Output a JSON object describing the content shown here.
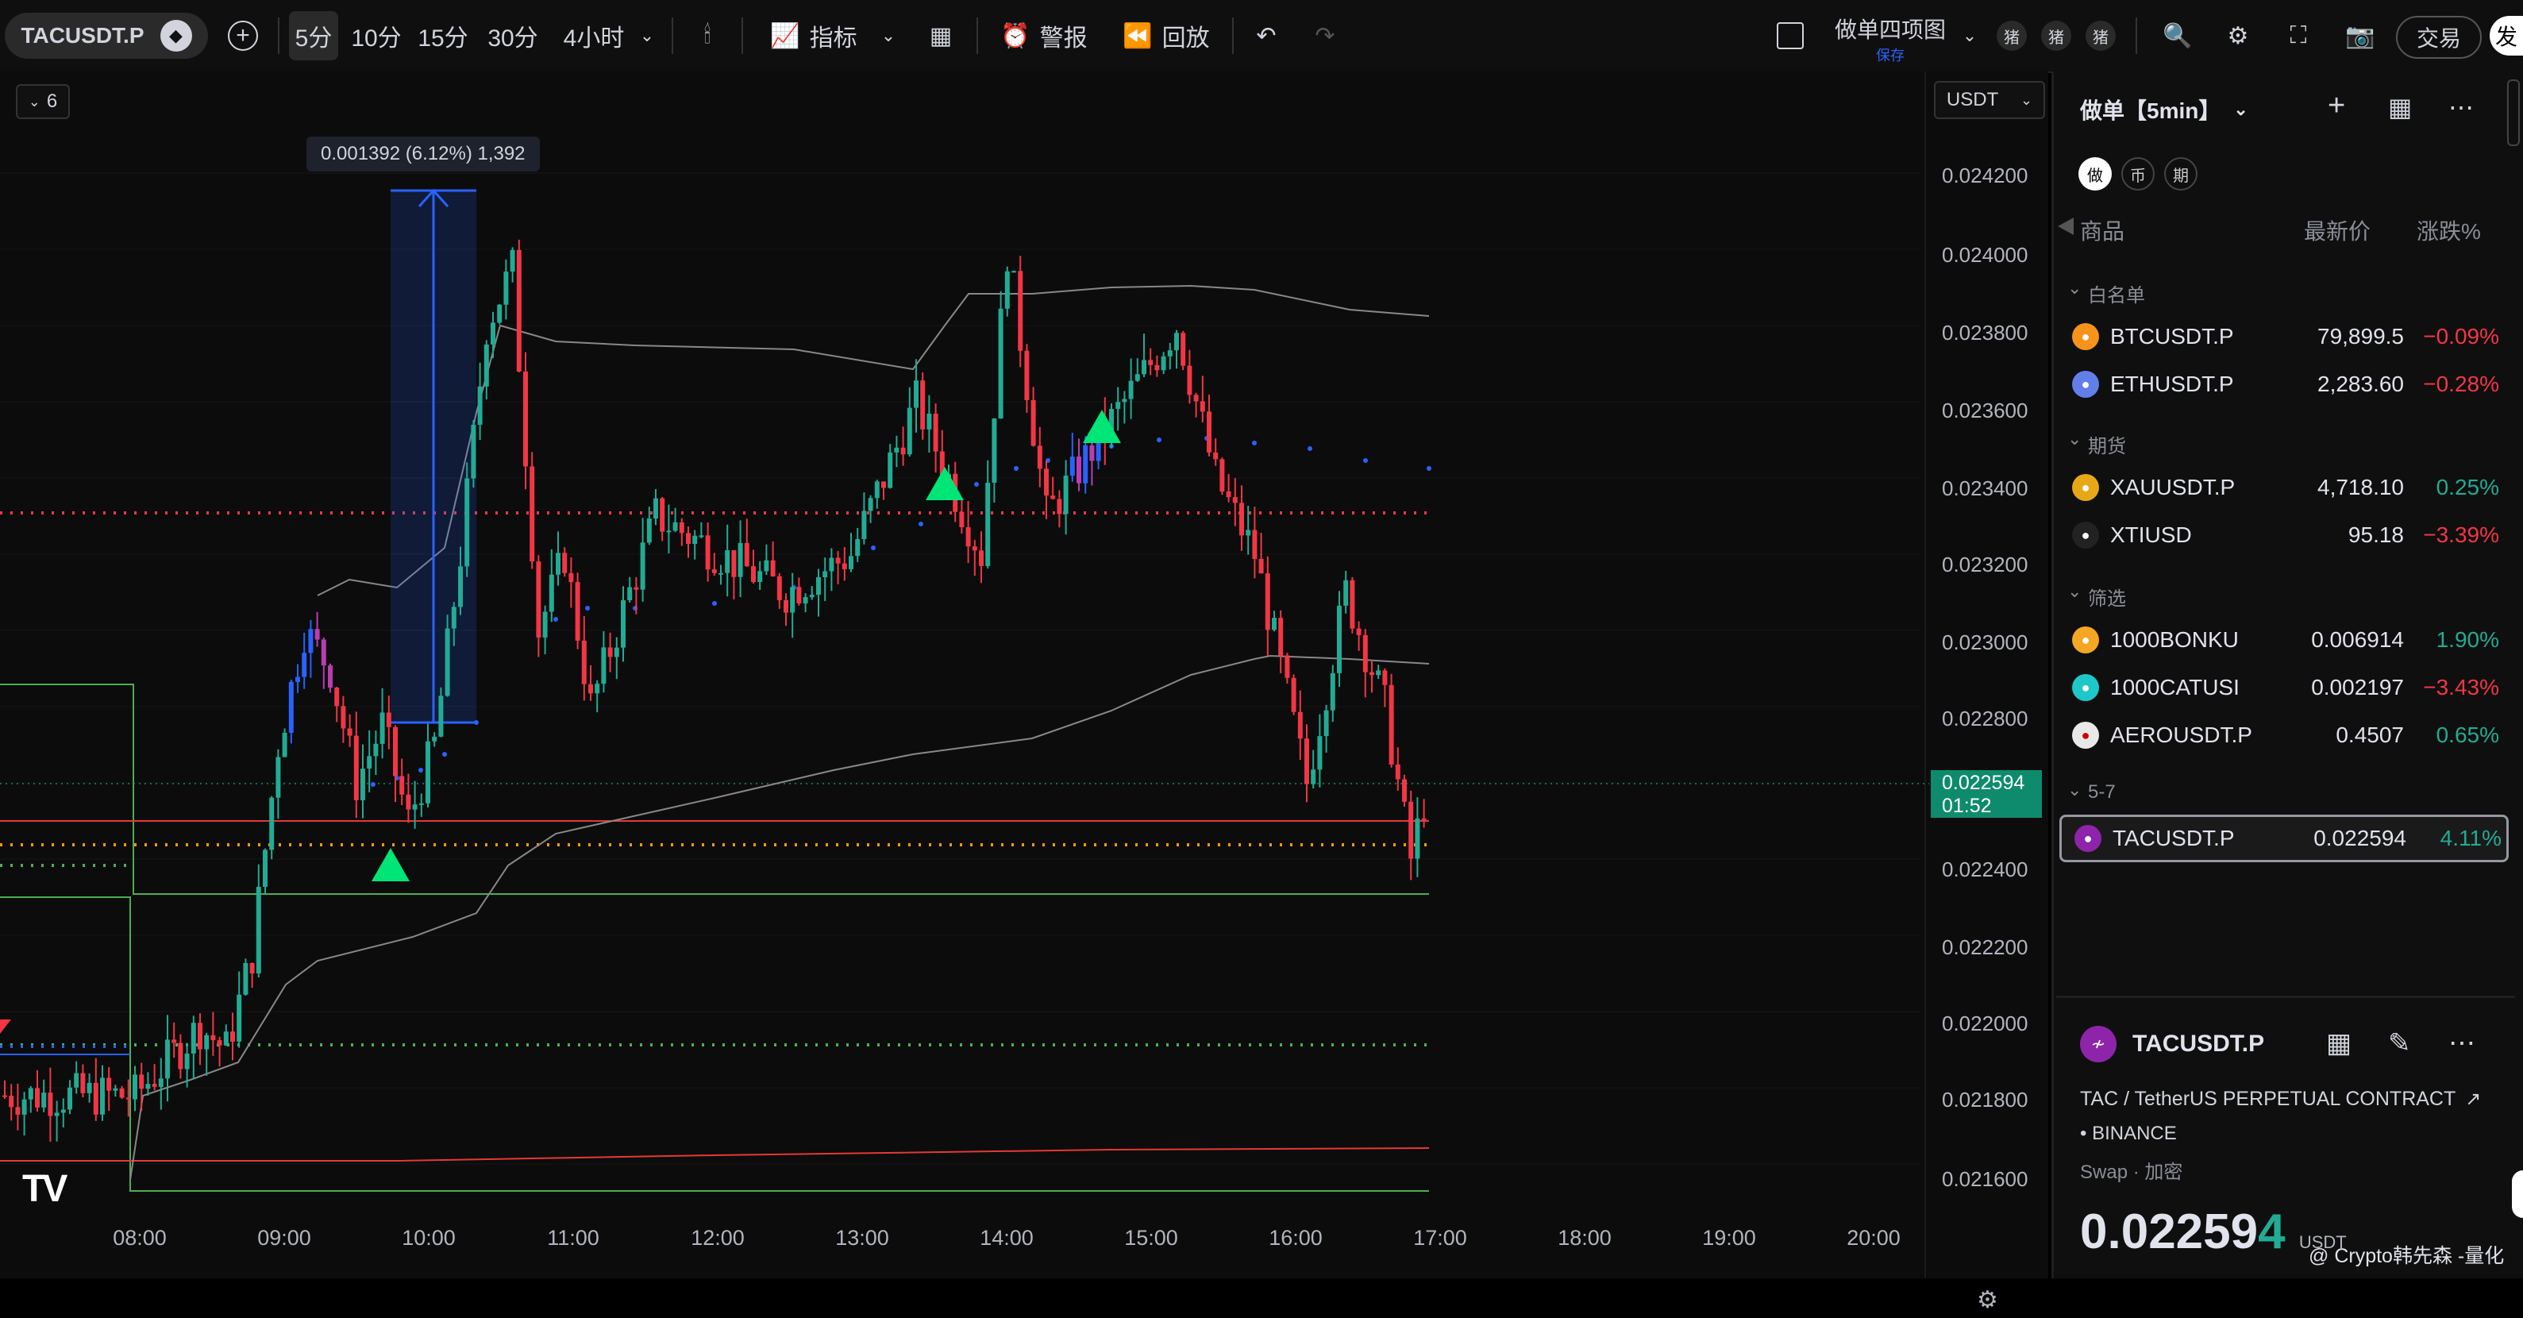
{
  "toolbar": {
    "symbol": "TACUSDT.P",
    "intervals": [
      "5分",
      "10分",
      "15分",
      "30分",
      "4小时"
    ],
    "active_interval": "5分",
    "indicators_label": "指标",
    "alert_label": "警报",
    "replay_label": "回放",
    "layout_name": "做单四项图",
    "layout_saved": "保存",
    "user_badges": [
      "猪",
      "猪",
      "猪"
    ],
    "trade_label": "交易",
    "publish_label": "发"
  },
  "chart": {
    "legend_count": "6",
    "currency": "USDT",
    "measure_tooltip": "0.001392 (6.12%) 1,392",
    "price_axis": [
      "0.024200",
      "0.024000",
      "0.023800",
      "0.023600",
      "0.023400",
      "0.023200",
      "0.023000",
      "0.022800",
      "0.022400",
      "0.022200",
      "0.022000",
      "0.021800",
      "0.021600"
    ],
    "current_price": "0.022594",
    "countdown": "01:52",
    "time_axis": [
      "08:00",
      "09:00",
      "10:00",
      "11:00",
      "12:00",
      "13:00",
      "14:00",
      "15:00",
      "16:00",
      "17:00",
      "18:00",
      "19:00",
      "20:00"
    ],
    "tv_logo": "TV"
  },
  "watchlist": {
    "title": "做单【5min】",
    "tabs": [
      "做",
      "币",
      "期"
    ],
    "col_symbol": "商品",
    "col_last": "最新价",
    "col_change": "涨跌%",
    "sections": [
      {
        "name": "白名单",
        "items": [
          {
            "symbol": "BTCUSDT.P",
            "price": "79,899.5",
            "change": "−0.09%",
            "dir": "neg",
            "icon_color": "#f7931a",
            "icon": "bitcoin-icon"
          },
          {
            "symbol": "ETHUSDT.P",
            "price": "2,283.60",
            "change": "−0.28%",
            "dir": "neg",
            "icon_color": "#627eea",
            "icon": "ethereum-icon"
          }
        ]
      },
      {
        "name": "期货",
        "items": [
          {
            "symbol": "XAUUSDT.P",
            "price": "4,718.10",
            "change": "0.25%",
            "dir": "pos",
            "icon_color": "#e6a817",
            "icon": "gold-icon"
          },
          {
            "symbol": "XTIUSD",
            "price": "95.18",
            "change": "−3.39%",
            "dir": "neg",
            "icon_color": "#222222",
            "icon": "oil-drop-icon"
          }
        ]
      },
      {
        "name": "筛选",
        "items": [
          {
            "symbol": "1000BONKU",
            "price": "0.006914",
            "change": "1.90%",
            "dir": "pos",
            "icon_color": "#f5a623",
            "icon": "bonk-icon"
          },
          {
            "symbol": "1000CATUSI",
            "price": "0.002197",
            "change": "−3.43%",
            "dir": "neg",
            "icon_color": "#1ec8c8",
            "icon": "cat-icon"
          },
          {
            "symbol": "AEROUSDT.P",
            "price": "0.4507",
            "change": "0.65%",
            "dir": "pos",
            "icon_color": "#e8e8e8",
            "icon": "aero-icon"
          }
        ]
      },
      {
        "name": "5-7",
        "items": [
          {
            "symbol": "TACUSDT.P",
            "price": "0.022594",
            "change": "4.11%",
            "dir": "pos",
            "icon_color": "#8e24aa",
            "icon": "tac-icon"
          }
        ]
      }
    ]
  },
  "details": {
    "symbol": "TACUSDT.P",
    "description": "TAC / TetherUS PERPETUAL CONTRACT",
    "exchange": "BINANCE",
    "tags": "Swap · 加密",
    "price": "0.02259",
    "price_last_digit": "4",
    "currency": "USDT",
    "watermark": "@ Crypto韩先森 -量化"
  },
  "colors": {
    "up": "#22ab94",
    "down": "#f23645",
    "blue": "#2962ff",
    "magenta": "#b93db0",
    "orange": "#ff9800",
    "green_dot": "#4caf50",
    "blue_dot": "#2962ff",
    "red_dot": "#f23645",
    "current_price_bg": "#0d8b6c"
  }
}
